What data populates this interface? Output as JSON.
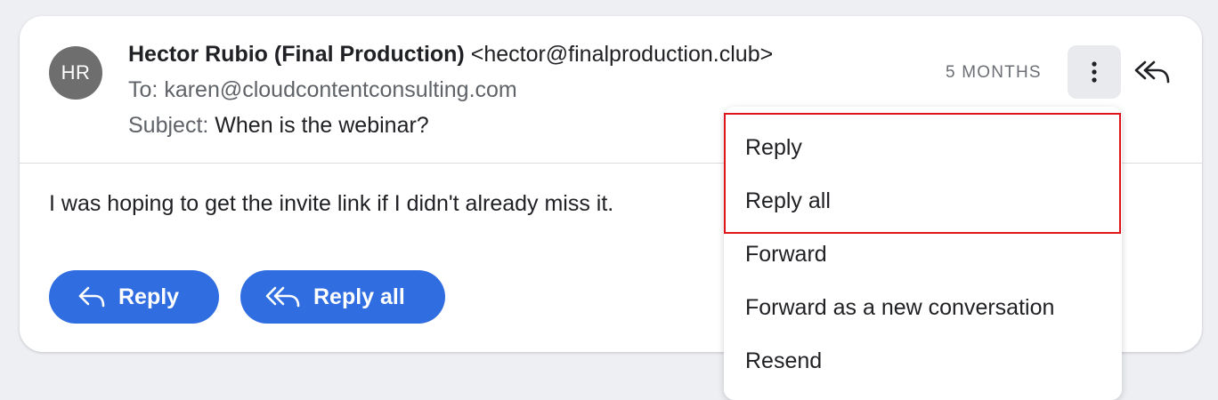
{
  "message": {
    "avatar_initials": "HR",
    "from_name": "Hector Rubio (Final Production)",
    "from_email": "<hector@finalproduction.club>",
    "to_label": "To:",
    "to_value": "karen@cloudcontentconsulting.com",
    "subject_label": "Subject:",
    "subject_value": "When is the webinar?",
    "time": "5 MONTHS",
    "body": "I was hoping to get the invite link if I didn't already miss it."
  },
  "actions": {
    "reply_label": "Reply",
    "reply_all_label": "Reply all",
    "more_icon": "more-vertical-icon",
    "reply_all_icon": "reply-all-icon"
  },
  "menu": {
    "items": [
      "Reply",
      "Reply all",
      "Forward",
      "Forward as a new conversation",
      "Resend"
    ]
  },
  "colors": {
    "accent": "#2f6de1",
    "highlight": "#e0141b",
    "avatar": "#6e6e6e"
  }
}
